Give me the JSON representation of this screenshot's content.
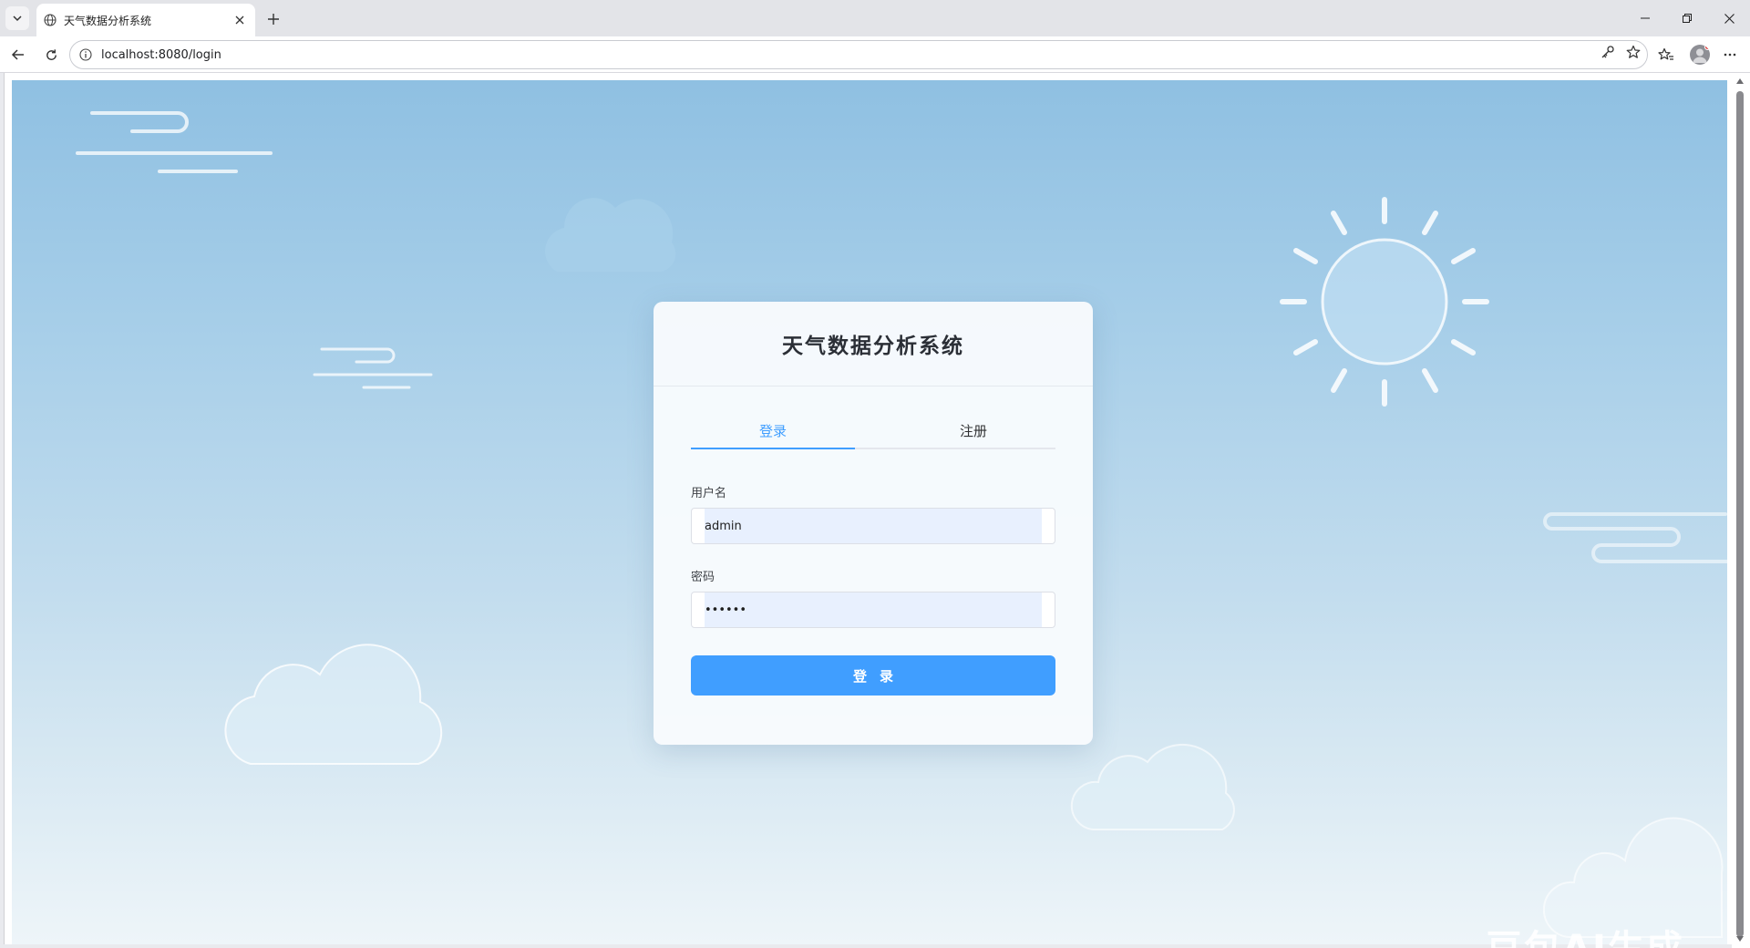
{
  "browser": {
    "tab_title": "天气数据分析系统",
    "url": "localhost:8080/login"
  },
  "login": {
    "title": "天气数据分析系统",
    "tabs": [
      {
        "label": "登录",
        "active": true
      },
      {
        "label": "注册",
        "active": false
      }
    ],
    "username_label": "用户名",
    "username_value": "admin",
    "password_label": "密码",
    "password_value": "••••••",
    "submit_label": "登录"
  },
  "watermark": "豆包AI生成",
  "colors": {
    "accent": "#409eff",
    "sky_top": "#8fc0e2",
    "sky_bottom": "#eef5f9"
  }
}
